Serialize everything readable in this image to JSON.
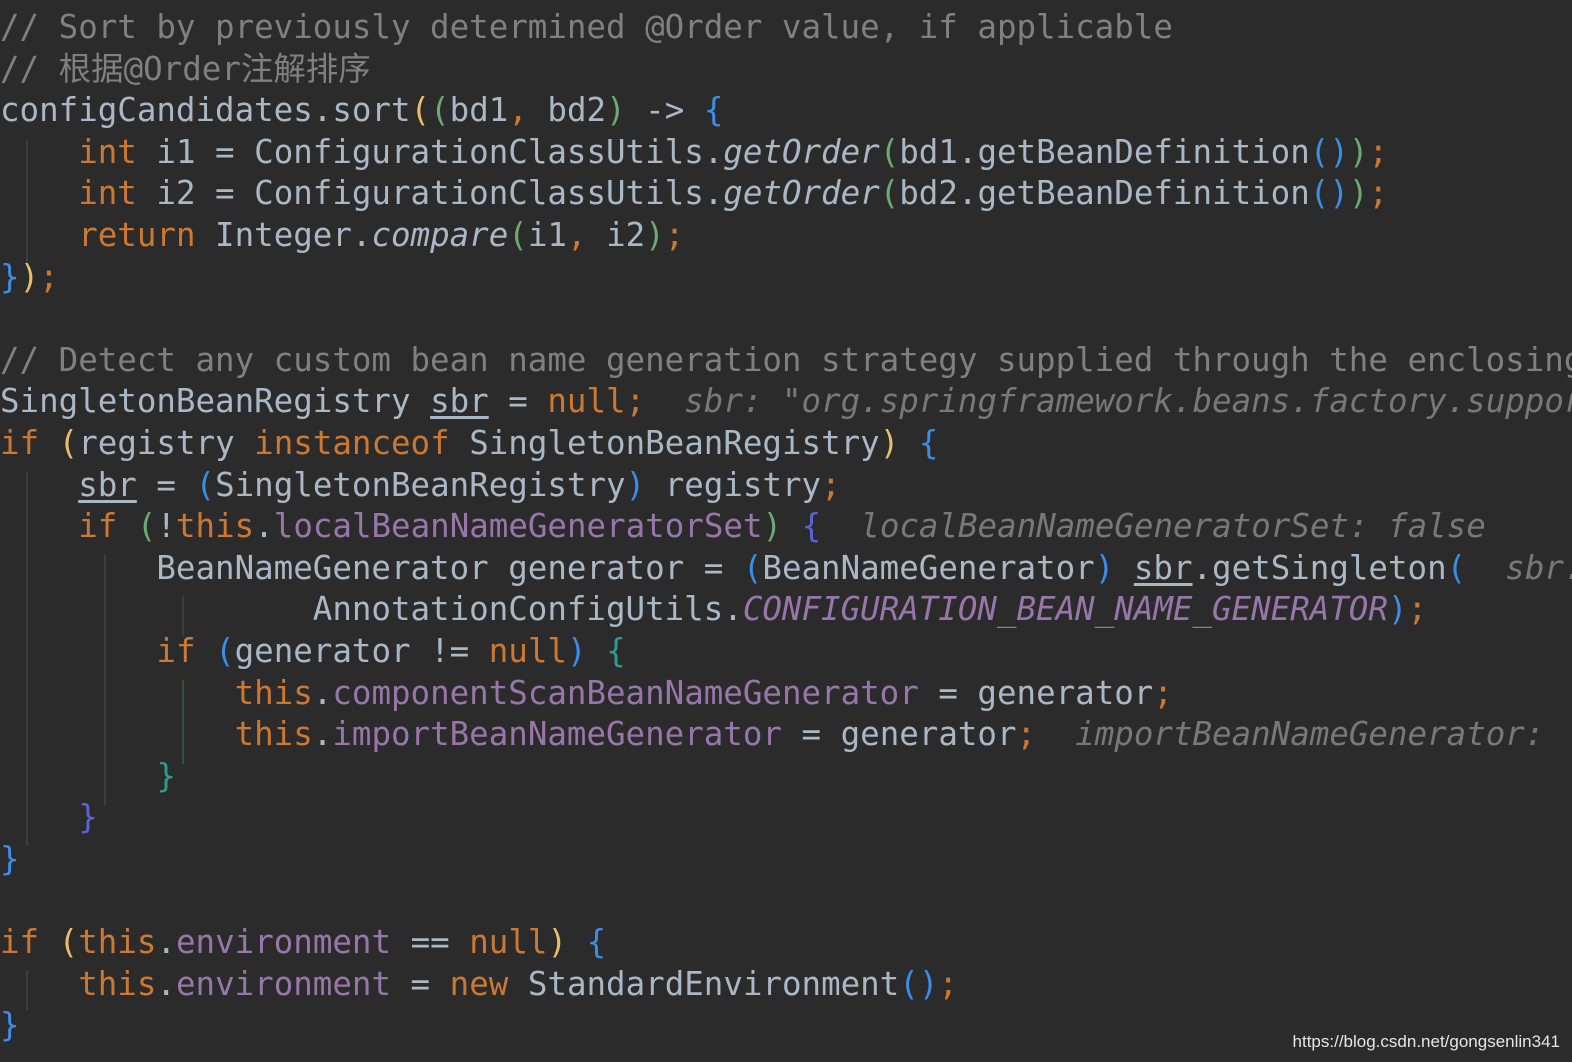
{
  "editor": {
    "background": "#2b2b2b",
    "lines": [
      [
        [
          "t-comment",
          "// Sort by previously determined @Order value, if applicable"
        ]
      ],
      [
        [
          "t-comment",
          "// 根据@Order注解排序"
        ]
      ],
      [
        [
          "t-plain",
          "configCandidates.sort"
        ],
        [
          "t-b1",
          "("
        ],
        [
          "t-b2",
          "("
        ],
        [
          "t-plain",
          "bd1"
        ],
        [
          "t-semi",
          ","
        ],
        [
          "t-plain",
          " bd2"
        ],
        [
          "t-b2",
          ")"
        ],
        [
          "t-plain",
          " -> "
        ],
        [
          "t-b3",
          "{"
        ]
      ],
      [
        [
          "t-plain",
          "    "
        ],
        [
          "t-kw",
          "int"
        ],
        [
          "t-plain",
          " i1 = ConfigurationClassUtils."
        ],
        [
          "t-method-italic",
          "getOrder"
        ],
        [
          "t-b2",
          "("
        ],
        [
          "t-plain",
          "bd1.getBeanDefinition"
        ],
        [
          "t-b3",
          "()"
        ],
        [
          "t-b2",
          ")"
        ],
        [
          "t-semi",
          ";"
        ]
      ],
      [
        [
          "t-plain",
          "    "
        ],
        [
          "t-kw",
          "int"
        ],
        [
          "t-plain",
          " i2 = ConfigurationClassUtils."
        ],
        [
          "t-method-italic",
          "getOrder"
        ],
        [
          "t-b2",
          "("
        ],
        [
          "t-plain",
          "bd2.getBeanDefinition"
        ],
        [
          "t-b3",
          "()"
        ],
        [
          "t-b2",
          ")"
        ],
        [
          "t-semi",
          ";"
        ]
      ],
      [
        [
          "t-plain",
          "    "
        ],
        [
          "t-kw",
          "return"
        ],
        [
          "t-plain",
          " Integer."
        ],
        [
          "t-method-italic",
          "compare"
        ],
        [
          "t-b2",
          "("
        ],
        [
          "t-plain",
          "i1"
        ],
        [
          "t-semi",
          ","
        ],
        [
          "t-plain",
          " i2"
        ],
        [
          "t-b2",
          ")"
        ],
        [
          "t-semi",
          ";"
        ]
      ],
      [
        [
          "t-b3",
          "}"
        ],
        [
          "t-b1",
          ")"
        ],
        [
          "t-semi",
          ";"
        ]
      ],
      [],
      [
        [
          "t-comment",
          "// Detect any custom bean name generation strategy supplied through the enclosing application context"
        ]
      ],
      [
        [
          "t-plain",
          "SingletonBeanRegistry "
        ],
        [
          "t-under",
          "sbr"
        ],
        [
          "t-plain",
          " = "
        ],
        [
          "t-kw",
          "null"
        ],
        [
          "t-semi",
          ";"
        ],
        [
          "t-plain",
          "  "
        ],
        [
          "t-hint",
          "sbr: \"org.springframework.beans.factory.support.DefaultListableBeanFactory\""
        ]
      ],
      [
        [
          "t-kw",
          "if"
        ],
        [
          "t-plain",
          " "
        ],
        [
          "t-b1",
          "("
        ],
        [
          "t-plain",
          "registry "
        ],
        [
          "t-kw",
          "instanceof"
        ],
        [
          "t-plain",
          " SingletonBeanRegistry"
        ],
        [
          "t-b1",
          ")"
        ],
        [
          "t-plain",
          " "
        ],
        [
          "t-b3",
          "{"
        ]
      ],
      [
        [
          "t-plain",
          "    "
        ],
        [
          "t-under",
          "sbr"
        ],
        [
          "t-plain",
          " = "
        ],
        [
          "t-b3",
          "("
        ],
        [
          "t-plain",
          "SingletonBeanRegistry"
        ],
        [
          "t-b3",
          ")"
        ],
        [
          "t-plain",
          " registry"
        ],
        [
          "t-semi",
          ";"
        ]
      ],
      [
        [
          "t-plain",
          "    "
        ],
        [
          "t-kw",
          "if"
        ],
        [
          "t-plain",
          " "
        ],
        [
          "t-b2",
          "("
        ],
        [
          "t-plain",
          "!"
        ],
        [
          "t-kw",
          "this"
        ],
        [
          "t-plain",
          "."
        ],
        [
          "t-field",
          "localBeanNameGeneratorSet"
        ],
        [
          "t-b2",
          ")"
        ],
        [
          "t-plain",
          " "
        ],
        [
          "t-b5",
          "{"
        ],
        [
          "t-plain",
          "  "
        ],
        [
          "t-hint",
          "localBeanNameGeneratorSet: false"
        ]
      ],
      [
        [
          "t-plain",
          "        BeanNameGenerator generator = "
        ],
        [
          "t-b3",
          "("
        ],
        [
          "t-plain",
          "BeanNameGenerator"
        ],
        [
          "t-b3",
          ")"
        ],
        [
          "t-plain",
          " "
        ],
        [
          "t-under",
          "sbr"
        ],
        [
          "t-plain",
          ".getSingleton"
        ],
        [
          "t-b3",
          "("
        ],
        [
          "t-plain",
          "  "
        ],
        [
          "t-hint",
          "sbr: \"org.springframework.beans.factory.support.DefaultListableBeanFactory\""
        ]
      ],
      [
        [
          "t-plain",
          "                AnnotationConfigUtils."
        ],
        [
          "t-static",
          "CONFIGURATION_BEAN_NAME_GENERATOR"
        ],
        [
          "t-b3",
          ")"
        ],
        [
          "t-semi",
          ";"
        ]
      ],
      [
        [
          "t-plain",
          "        "
        ],
        [
          "t-kw",
          "if"
        ],
        [
          "t-plain",
          " "
        ],
        [
          "t-b3",
          "("
        ],
        [
          "t-plain",
          "generator != "
        ],
        [
          "t-kw",
          "null"
        ],
        [
          "t-b3",
          ")"
        ],
        [
          "t-plain",
          " "
        ],
        [
          "t-b4",
          "{"
        ]
      ],
      [
        [
          "t-plain",
          "            "
        ],
        [
          "t-kw",
          "this"
        ],
        [
          "t-plain",
          "."
        ],
        [
          "t-field",
          "componentScanBeanNameGenerator"
        ],
        [
          "t-plain",
          " = generator"
        ],
        [
          "t-semi",
          ";"
        ]
      ],
      [
        [
          "t-plain",
          "            "
        ],
        [
          "t-kw",
          "this"
        ],
        [
          "t-plain",
          "."
        ],
        [
          "t-field",
          "importBeanNameGenerator"
        ],
        [
          "t-plain",
          " = generator"
        ],
        [
          "t-semi",
          ";"
        ],
        [
          "t-plain",
          "  "
        ],
        [
          "t-hint",
          "importBeanNameGenerator: "
        ]
      ],
      [
        [
          "t-plain",
          "        "
        ],
        [
          "t-b4",
          "}"
        ]
      ],
      [
        [
          "t-plain",
          "    "
        ],
        [
          "t-b5",
          "}"
        ]
      ],
      [
        [
          "t-b3",
          "}"
        ]
      ],
      [],
      [
        [
          "t-kw",
          "if"
        ],
        [
          "t-plain",
          " "
        ],
        [
          "t-b1",
          "("
        ],
        [
          "t-kw",
          "this"
        ],
        [
          "t-plain",
          "."
        ],
        [
          "t-field",
          "environment"
        ],
        [
          "t-plain",
          " == "
        ],
        [
          "t-kw",
          "null"
        ],
        [
          "t-b1",
          ")"
        ],
        [
          "t-plain",
          " "
        ],
        [
          "t-b3",
          "{"
        ]
      ],
      [
        [
          "t-plain",
          "    "
        ],
        [
          "t-kw",
          "this"
        ],
        [
          "t-plain",
          "."
        ],
        [
          "t-field",
          "environment"
        ],
        [
          "t-plain",
          " = "
        ],
        [
          "t-kw",
          "new"
        ],
        [
          "t-plain",
          " StandardEnvironment"
        ],
        [
          "t-b3",
          "()"
        ],
        [
          "t-semi",
          ";"
        ]
      ],
      [
        [
          "t-b3",
          "}"
        ]
      ]
    ]
  },
  "watermark": {
    "text": "https://blog.csdn.net/gongsenlin341"
  }
}
